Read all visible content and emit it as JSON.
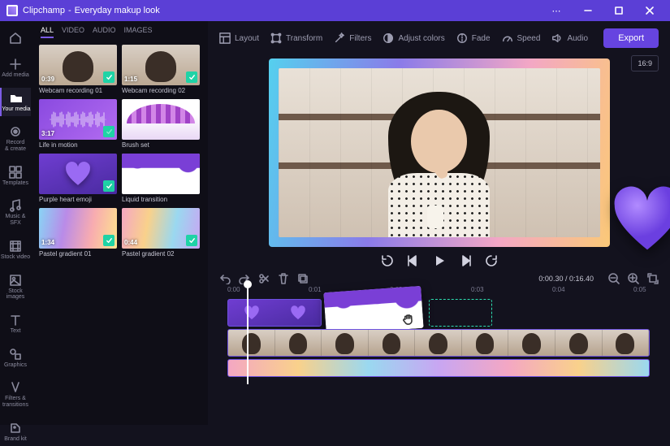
{
  "app": {
    "name": "Clipchamp",
    "project": "Everyday makup look"
  },
  "window": {
    "more": "⋯"
  },
  "rail": [
    {
      "id": "home",
      "label": ""
    },
    {
      "id": "add-media",
      "label": "Add media"
    },
    {
      "id": "your-media",
      "label": "Your media"
    },
    {
      "id": "record",
      "label": "Record\n& create"
    },
    {
      "id": "templates",
      "label": "Templates"
    },
    {
      "id": "music",
      "label": "Music & SFX"
    },
    {
      "id": "stock-video",
      "label": "Stock video"
    },
    {
      "id": "stock-images",
      "label": "Stock images"
    },
    {
      "id": "text",
      "label": "Text"
    },
    {
      "id": "graphics",
      "label": "Graphics"
    },
    {
      "id": "filters",
      "label": "Filters &\ntransitions"
    },
    {
      "id": "brand",
      "label": "Brand kit"
    }
  ],
  "mediaTabs": [
    "ALL",
    "VIDEO",
    "AUDIO",
    "IMAGES"
  ],
  "media": [
    {
      "title": "Webcam recording 01",
      "duration": "0:39",
      "checked": true,
      "style": "t-webcam"
    },
    {
      "title": "Webcam recording 02",
      "duration": "1:15",
      "checked": true,
      "style": "t-webcam"
    },
    {
      "title": "Life in motion",
      "duration": "3:17",
      "checked": true,
      "style": "t-audio"
    },
    {
      "title": "Brush set",
      "duration": "",
      "checked": false,
      "style": "t-brush"
    },
    {
      "title": "Purple heart emoji",
      "duration": "",
      "checked": true,
      "style": "t-heart"
    },
    {
      "title": "Liquid transition",
      "duration": "",
      "checked": false,
      "style": "t-liquid"
    },
    {
      "title": "Pastel gradient 01",
      "duration": "1:34",
      "checked": true,
      "style": "t-grad1"
    },
    {
      "title": "Pastel gradient 02",
      "duration": "0:44",
      "checked": true,
      "style": "t-grad2"
    }
  ],
  "toolbar": {
    "layout": "Layout",
    "transform": "Transform",
    "filters": "Filters",
    "adjust": "Adjust colors",
    "fade": "Fade",
    "speed": "Speed",
    "audio": "Audio",
    "export": "Export"
  },
  "preview": {
    "ratio": "16:9"
  },
  "timeline": {
    "current": "0:00.30",
    "total": "0:16.40",
    "ticks": [
      "0:00",
      "0:01",
      "0:02",
      "0:03",
      "0:04",
      "0:05"
    ]
  }
}
